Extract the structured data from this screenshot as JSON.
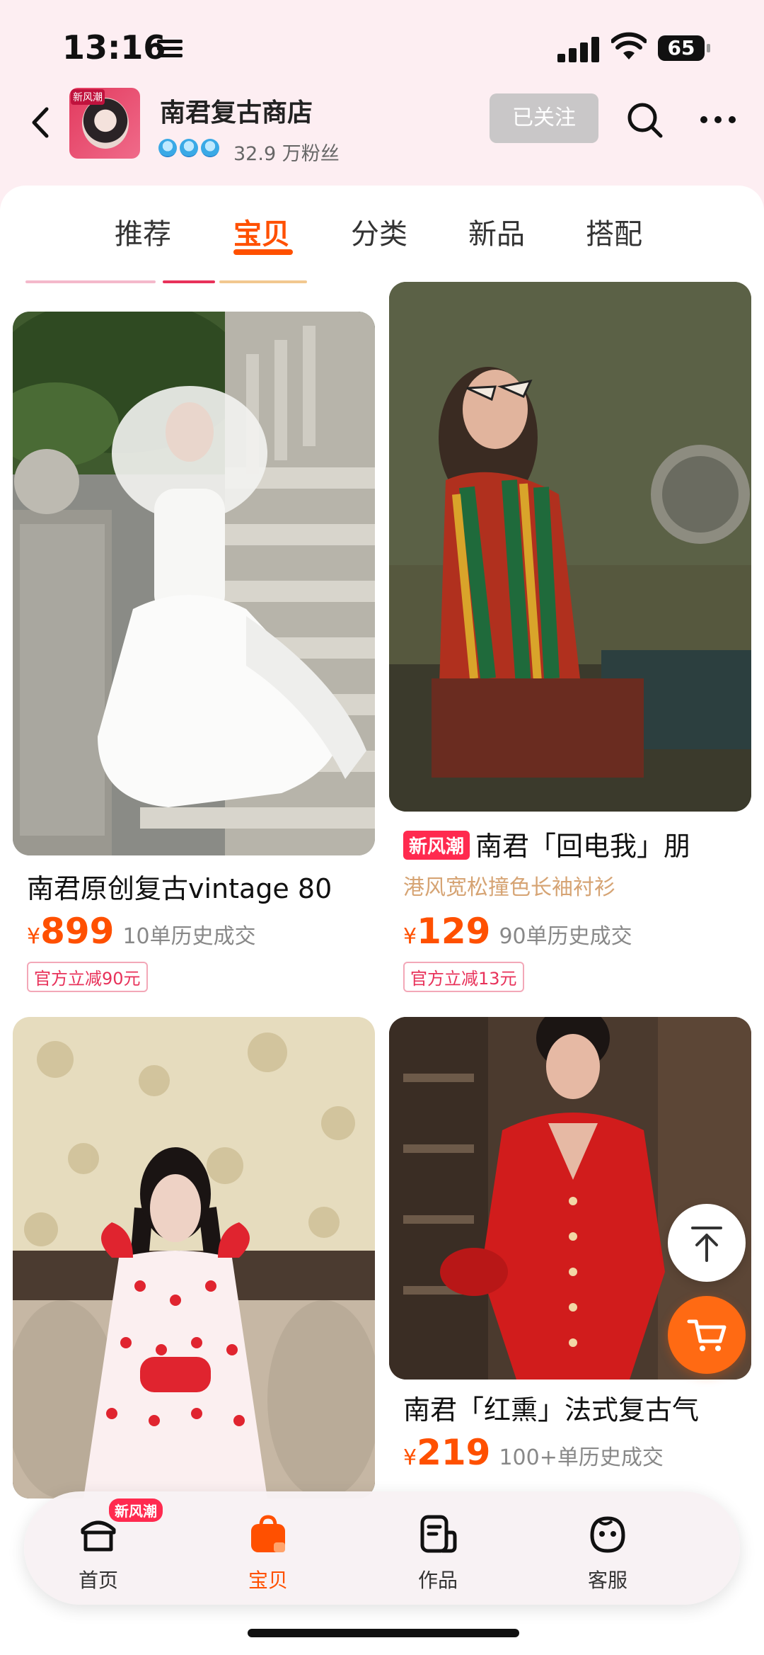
{
  "status_bar": {
    "time": "13:16",
    "battery": "65"
  },
  "shop": {
    "name": "南君复古商店",
    "fans": "32.9 万粉丝",
    "follow_label": "已关注",
    "logo_tag": "新风潮"
  },
  "tabs": [
    {
      "label": "推荐"
    },
    {
      "label": "宝贝"
    },
    {
      "label": "分类"
    },
    {
      "label": "新品"
    },
    {
      "label": "搭配"
    }
  ],
  "products": [
    {
      "title": "南君原创复古vintage 80",
      "subtitle": "",
      "yen": "¥",
      "price": "899",
      "sold": "10单历史成交",
      "coupon": "官方立减90元"
    },
    {
      "badge": "新风潮",
      "title": "南君「回电我」朋",
      "subtitle": "港风宽松撞色长袖衬衫",
      "yen": "¥",
      "price": "129",
      "sold": "90单历史成交",
      "coupon": "官方立减13元"
    },
    {
      "title": "",
      "subtitle": "",
      "price": "",
      "sold": ""
    },
    {
      "title": "南君「红熏」法式复古气",
      "subtitle": "",
      "yen": "¥",
      "price": "219",
      "sold": "100+单历史成交"
    }
  ],
  "bottom_nav": [
    {
      "label": "首页",
      "badge": "新风潮",
      "icon": "shop-home-icon"
    },
    {
      "label": "宝贝",
      "icon": "bag-icon",
      "active": true
    },
    {
      "label": "作品",
      "icon": "works-icon"
    },
    {
      "label": "客服",
      "icon": "customer-service-icon"
    }
  ],
  "colors": {
    "accent": "#ff5000",
    "badge": "#ff2a4f",
    "header_bg": "#fdeef2"
  }
}
